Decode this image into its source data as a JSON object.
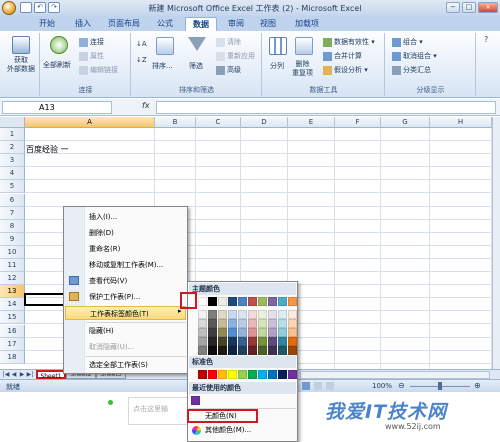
{
  "titlebar": {
    "title": "新建 Microsoft Office Excel 工作表 (2) - Microsoft Excel",
    "minimize": "−",
    "maximize": "□",
    "close": "×"
  },
  "qat": {
    "save": "",
    "undo": "↶",
    "redo": "↷"
  },
  "tabs": [
    {
      "label": "开始"
    },
    {
      "label": "插入"
    },
    {
      "label": "页面布局"
    },
    {
      "label": "公式"
    },
    {
      "label": "数据",
      "active": true
    },
    {
      "label": "审阅"
    },
    {
      "label": "视图"
    },
    {
      "label": "加载项"
    }
  ],
  "ribbon": {
    "groups": {
      "connections": "连接",
      "sort_filter": "排序和筛选",
      "data_tools": "数据工具",
      "outline": "分级显示"
    },
    "get_external": "获取\n外部数据",
    "refresh_all": "全部刷新",
    "connections": "连接",
    "properties": "属性",
    "edit_links": "编辑链接",
    "sort": "排序...",
    "filter": "筛选",
    "clear": "清除",
    "reapply": "重新应用",
    "advanced": "高级",
    "text_to_columns": "分列",
    "remove_duplicates": "删除\n重复项",
    "data_validation": "数据有效性",
    "consolidate": "合并计算",
    "what_if": "假设分析",
    "group": "组合",
    "ungroup": "取消组合",
    "subtotal": "分类汇总"
  },
  "formula_bar": {
    "name_box": "A13",
    "fx": "fx",
    "value": ""
  },
  "columns": [
    "A",
    "B",
    "C",
    "D",
    "E",
    "F",
    "G",
    "H"
  ],
  "rows": [
    "1",
    "2",
    "3",
    "4",
    "5",
    "6",
    "7",
    "8",
    "9",
    "10",
    "11",
    "12",
    "13",
    "14",
    "15",
    "16",
    "17",
    "18"
  ],
  "cells": {
    "A2": "百度经验 一"
  },
  "sheet_tabs": [
    "Sheet1",
    "Sheet2",
    "Sheet3"
  ],
  "status": {
    "ready": "就绪",
    "zoom": "100%"
  },
  "context_menu": [
    {
      "label": "插入(I)..."
    },
    {
      "label": "删除(D)"
    },
    {
      "label": "重命名(R)"
    },
    {
      "label": "移动或复制工作表(M)..."
    },
    {
      "label": "查看代码(V)",
      "icon": "view-code-icon"
    },
    {
      "label": "保护工作表(P)...",
      "icon": "protect-sheet-icon"
    },
    {
      "label": "工作表标签颜色(T)",
      "highlighted": true,
      "has_submenu": true
    },
    {
      "label": "隐藏(H)"
    },
    {
      "label": "取消隐藏(U)...",
      "disabled": true
    },
    {
      "label": "选定全部工作表(S)"
    }
  ],
  "color_menu": {
    "theme_label": "主题颜色",
    "standard_label": "标准色",
    "recent_label": "最近使用的颜色",
    "no_color": "无颜色(N)",
    "more_colors": "其他颜色(M)...",
    "theme_top": [
      "#ffffff",
      "#000000",
      "#eeece1",
      "#1f497d",
      "#4f81bd",
      "#c0504d",
      "#9bbb59",
      "#8064a2",
      "#4bacc6",
      "#f79646"
    ],
    "theme_shades": [
      [
        "#f2f2f2",
        "#7f7f7f",
        "#ddd9c3",
        "#c6d9f0",
        "#dbe5f1",
        "#f2dcdb",
        "#ebf1dd",
        "#e5e0ec",
        "#dbeef3",
        "#fdeada"
      ],
      [
        "#d8d8d8",
        "#595959",
        "#c4bd97",
        "#8db3e2",
        "#b8cce4",
        "#e5b9b7",
        "#d7e3bc",
        "#ccc1d9",
        "#b7dde8",
        "#fbd5b5"
      ],
      [
        "#bfbfbf",
        "#3f3f3f",
        "#938953",
        "#548dd4",
        "#95b3d7",
        "#d99694",
        "#c3d69b",
        "#b2a2c7",
        "#92cddc",
        "#fac08f"
      ],
      [
        "#a5a5a5",
        "#262626",
        "#494429",
        "#17365d",
        "#366092",
        "#953734",
        "#76923c",
        "#5f497a",
        "#31859b",
        "#e36c09"
      ],
      [
        "#7f7f7f",
        "#0c0c0c",
        "#1d1b10",
        "#0f243e",
        "#244061",
        "#632423",
        "#4f6128",
        "#3f3151",
        "#205867",
        "#974806"
      ]
    ],
    "standard": [
      "#c00000",
      "#ff0000",
      "#ffc000",
      "#ffff00",
      "#92d050",
      "#00b050",
      "#00b0f0",
      "#0070c0",
      "#002060",
      "#7030a0"
    ],
    "recent": [
      "#7030a0"
    ]
  },
  "taskpane": {
    "placeholder": "点击这里输"
  },
  "watermark": {
    "text": "我爱IT技术网",
    "url": "www.52ij.com"
  }
}
